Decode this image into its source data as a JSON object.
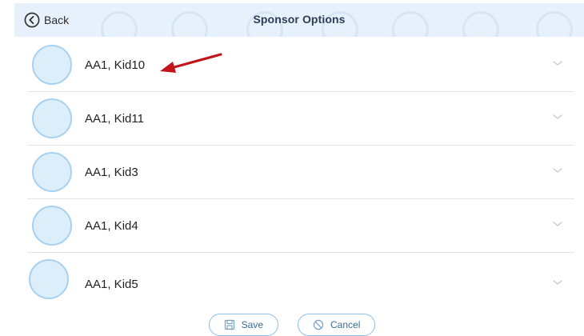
{
  "header": {
    "back_label": "Back",
    "title": "Sponsor Options",
    "background": "#e6f1fb"
  },
  "list": {
    "items": [
      {
        "label": "AA1, Kid10"
      },
      {
        "label": "AA1, Kid11"
      },
      {
        "label": "AA1, Kid3"
      },
      {
        "label": "AA1, Kid4"
      },
      {
        "label": "AA1, Kid5"
      }
    ],
    "item_icon": "chevron-down-icon"
  },
  "footer": {
    "save_label": "Save",
    "cancel_label": "Cancel",
    "save_icon": "floppy-disk-icon",
    "cancel_icon": "cancel-circle-icon"
  },
  "annotation": {
    "type": "arrow",
    "color": "#c0161b",
    "points_to": "AA1, Kid10"
  },
  "colors": {
    "accent": "#8fbfe6",
    "avatar_fill": "#ddeefb",
    "avatar_border": "#a7d1f2",
    "title_text": "#2e3e56"
  }
}
